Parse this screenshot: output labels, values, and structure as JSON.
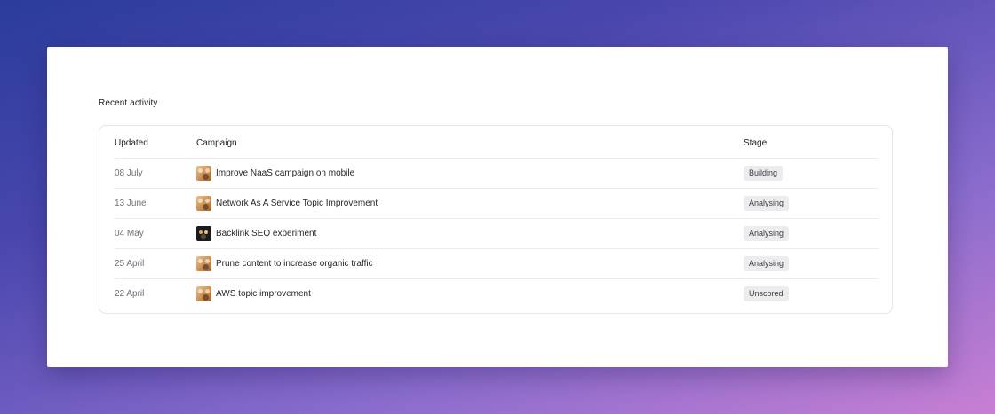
{
  "section": {
    "title": "Recent activity"
  },
  "table": {
    "columns": {
      "updated": "Updated",
      "campaign": "Campaign",
      "stage": "Stage"
    },
    "rows": [
      {
        "updated": "08 July",
        "campaign": "Improve NaaS campaign on mobile",
        "stage": "Building",
        "avatar_icon": "avatar-warm-icon"
      },
      {
        "updated": "13 June",
        "campaign": "Network As A Service Topic Improvement",
        "stage": "Analysing",
        "avatar_icon": "avatar-warm-icon"
      },
      {
        "updated": "04 May",
        "campaign": "Backlink SEO experiment",
        "stage": "Analysing",
        "avatar_icon": "avatar-dark-icon"
      },
      {
        "updated": "25 April",
        "campaign": "Prune content to increase organic traffic",
        "stage": "Analysing",
        "avatar_icon": "avatar-warm-icon"
      },
      {
        "updated": "22 April",
        "campaign": "AWS topic improvement",
        "stage": "Unscored",
        "avatar_icon": "avatar-warm-icon"
      }
    ]
  },
  "colors": {
    "background_start": "#2a3c9c",
    "background_end": "#c77fd3",
    "panel": "#ffffff",
    "badge_bg": "#ececef"
  }
}
